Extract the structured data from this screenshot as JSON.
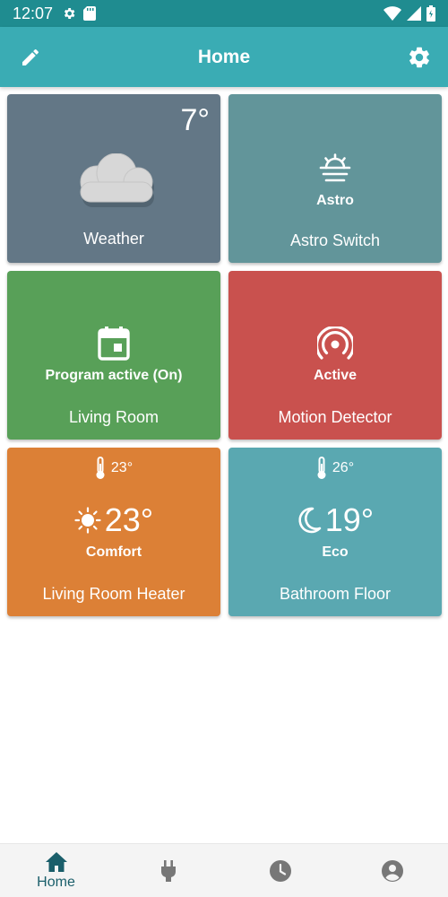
{
  "status_bar": {
    "time": "12:07",
    "icons_left": [
      "settings-icon",
      "sd-card-icon"
    ],
    "icons_right": [
      "wifi-icon",
      "signal-icon",
      "battery-icon"
    ]
  },
  "app_bar": {
    "title": "Home",
    "left_icon": "edit-icon",
    "right_icon": "settings-icon",
    "color": "#3aacb4"
  },
  "tiles": [
    {
      "name": "Weather",
      "temperature": "7°",
      "icon": "cloud-icon",
      "color": "#637786"
    },
    {
      "name": "Astro Switch",
      "status": "Astro",
      "icon": "sunrise-icon",
      "color": "#62959a"
    },
    {
      "name": "Living Room",
      "status": "Program active (On)",
      "icon": "calendar-icon",
      "color": "#58a058"
    },
    {
      "name": "Motion Detector",
      "status": "Active",
      "icon": "radar-icon",
      "color": "#c9514e"
    },
    {
      "name": "Living Room Heater",
      "measured_temp": "23°",
      "set_temp": "23°",
      "mode": "Comfort",
      "mode_icon": "sun-icon",
      "color": "#dc8036"
    },
    {
      "name": "Bathroom Floor",
      "measured_temp": "26°",
      "set_temp": "19°",
      "mode": "Eco",
      "mode_icon": "moon-icon",
      "color": "#5aa8b1"
    }
  ],
  "bottom_nav": {
    "items": [
      {
        "label": "Home",
        "icon": "home-icon",
        "active": true
      },
      {
        "label": "",
        "icon": "plug-icon",
        "active": false
      },
      {
        "label": "",
        "icon": "clock-icon",
        "active": false
      },
      {
        "label": "",
        "icon": "account-icon",
        "active": false
      }
    ]
  }
}
